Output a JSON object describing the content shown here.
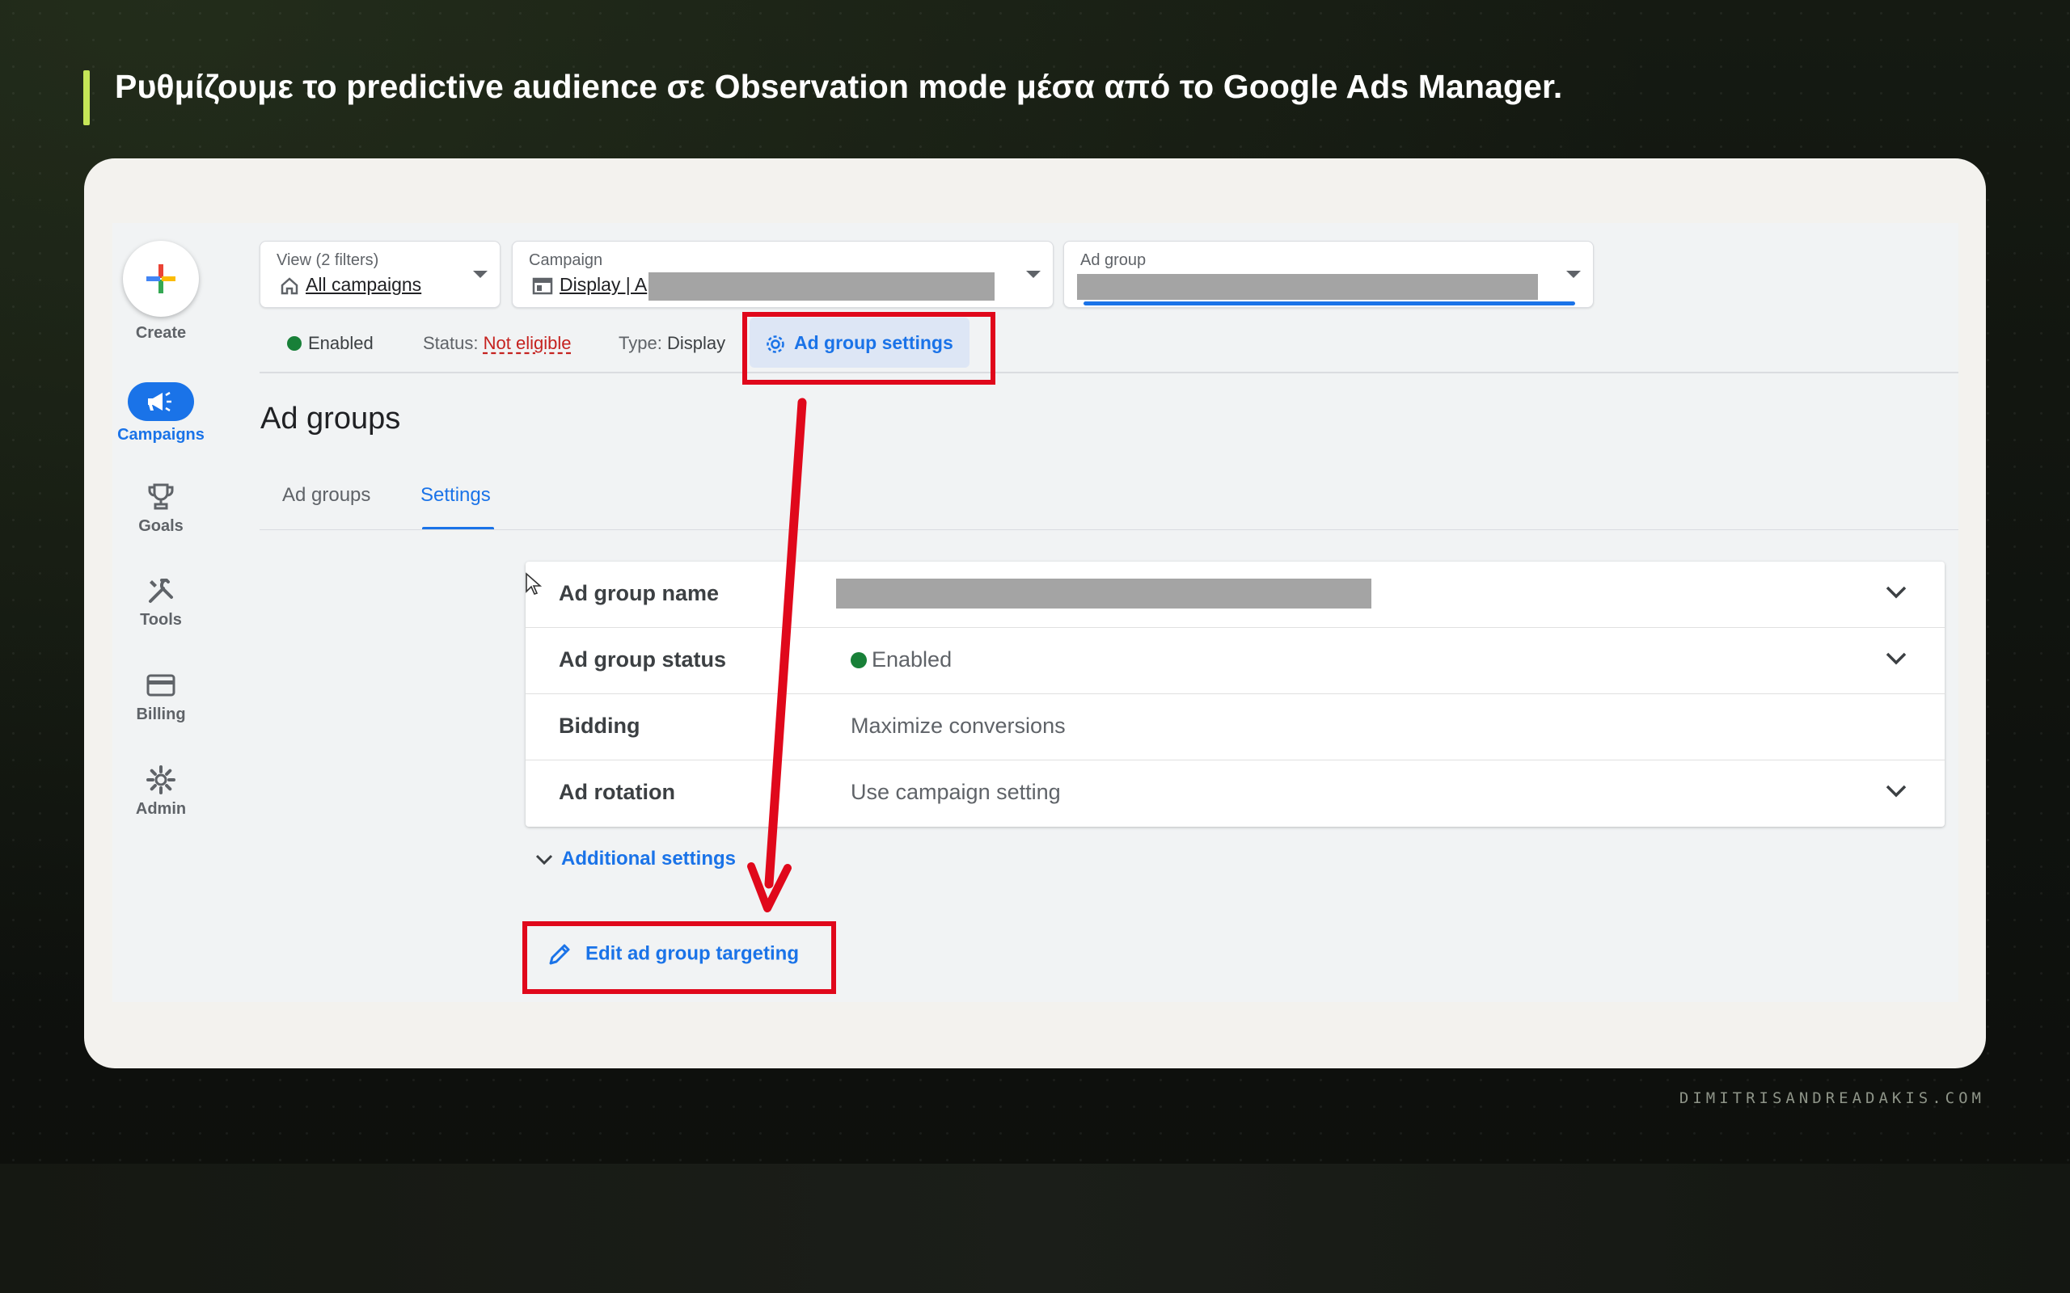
{
  "heading": "Ρυθμίζουμε το predictive audience σε Observation mode μέσα από το Google Ads Manager.",
  "footer_credit": "DIMITRISANDREADAKIS.COM",
  "colors": {
    "accent_bar": "#c5e557",
    "google_blue": "#1a73e8",
    "enabled_green": "#188038",
    "annotation_red": "#e0081b"
  },
  "nav": {
    "create": "Create",
    "items": [
      {
        "label": "Campaigns",
        "icon": "megaphone-icon",
        "active": true
      },
      {
        "label": "Goals",
        "icon": "trophy-icon"
      },
      {
        "label": "Tools",
        "icon": "tools-icon"
      },
      {
        "label": "Billing",
        "icon": "credit-card-icon"
      },
      {
        "label": "Admin",
        "icon": "gear-icon"
      }
    ]
  },
  "filters": {
    "view": {
      "label": "View (2 filters)",
      "value": "All campaigns",
      "icon": "home-icon"
    },
    "campaign": {
      "label": "Campaign",
      "value": "Display | A",
      "icon": "display-icon"
    },
    "ad_group": {
      "label": "Ad group"
    }
  },
  "status_bar": {
    "enabled": "Enabled",
    "status_label": "Status:",
    "status_value": "Not eligible",
    "type_label": "Type:",
    "type_value": "Display",
    "settings_button": "Ad group settings"
  },
  "page_title": "Ad groups",
  "tabs": [
    {
      "label": "Ad groups"
    },
    {
      "label": "Settings",
      "active": true
    }
  ],
  "settings_rows": [
    {
      "label": "Ad group name",
      "value": "",
      "expandable": true
    },
    {
      "label": "Ad group status",
      "value": "Enabled",
      "expandable": true
    },
    {
      "label": "Bidding",
      "value": "Maximize conversions",
      "expandable": false
    },
    {
      "label": "Ad rotation",
      "value": "Use campaign setting",
      "expandable": true
    }
  ],
  "additional_settings": "Additional settings",
  "edit_targeting": "Edit ad group targeting"
}
